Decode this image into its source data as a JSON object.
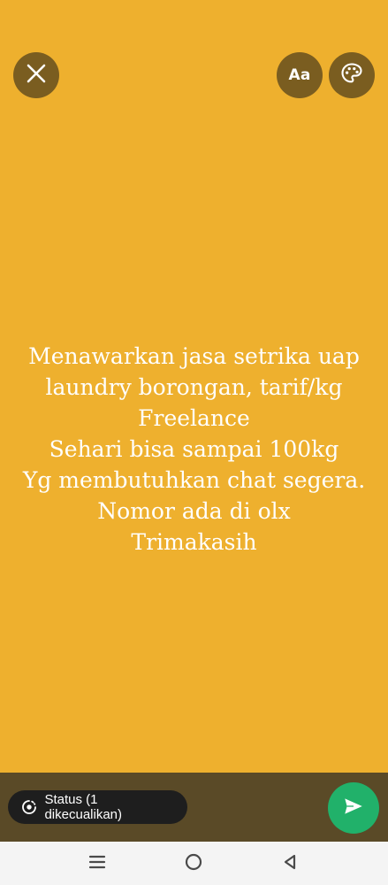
{
  "toolbar": {
    "close_icon": "close-icon",
    "text_style_label": "Aa",
    "palette_icon": "palette-icon"
  },
  "message": {
    "lines": [
      "Menawarkan jasa setrika uap",
      "laundry borongan, tarif/kg",
      "Freelance",
      "Sehari bisa sampai 100kg",
      "Yg membutuhkan chat segera.",
      "Nomor ada di olx",
      "Trimakasih"
    ]
  },
  "bottom": {
    "status_label": "Status (1 dikecualikan)",
    "status_icon": "status-icon",
    "send_icon": "send-icon"
  },
  "nav": {
    "recents_icon": "recents-icon",
    "home_icon": "home-icon",
    "back_icon": "back-icon"
  },
  "colors": {
    "background": "#EEB02E",
    "button_bg": "#7A5D20",
    "bottom_bar": "#5A4A27",
    "send": "#21B16A",
    "chip": "#1E1E1E"
  }
}
